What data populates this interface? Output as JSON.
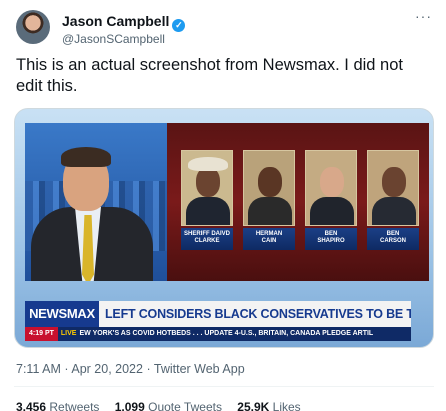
{
  "author": {
    "name": "Jason Campbell",
    "handle": "@JasonSCampbell",
    "verified_icon": "verified-badge-icon",
    "more_label": "···"
  },
  "tweet": {
    "text": "This is an actual screenshot from Newsmax. I did not edit this."
  },
  "media": {
    "people": [
      {
        "label_line1": "SHERIFF DAIVD",
        "label_line2": "CLARKE"
      },
      {
        "label_line1": "HERMAN",
        "label_line2": "CAIN"
      },
      {
        "label_line1": "BEN",
        "label_line2": "SHAPIRO"
      },
      {
        "label_line1": "BEN",
        "label_line2": "CARSON"
      }
    ],
    "logo": "NEWSMAX",
    "headline": "LEFT CONSIDERS BLACK CONSERVATIVES TO BE TRAITORS",
    "ticker_time": "4:19 PT",
    "ticker_live": "LIVE",
    "ticker_text": "EW YORK'S AS COVID HOTBEDS . . .   UPDATE 4-U.S., BRITAIN, CANADA PLEDGE ARTIL"
  },
  "meta": {
    "time": "7:11 AM",
    "date": "Apr 20, 2022",
    "source": "Twitter Web App"
  },
  "stats": {
    "retweets_count": "3,456",
    "retweets_label": "Retweets",
    "quotes_count": "1,099",
    "quotes_label": "Quote Tweets",
    "likes_count": "25.9K",
    "likes_label": "Likes"
  },
  "colors": {
    "verified": "#1d9bf0",
    "newsmax_blue": "#163a8f",
    "newsmax_red": "#c8102e"
  }
}
